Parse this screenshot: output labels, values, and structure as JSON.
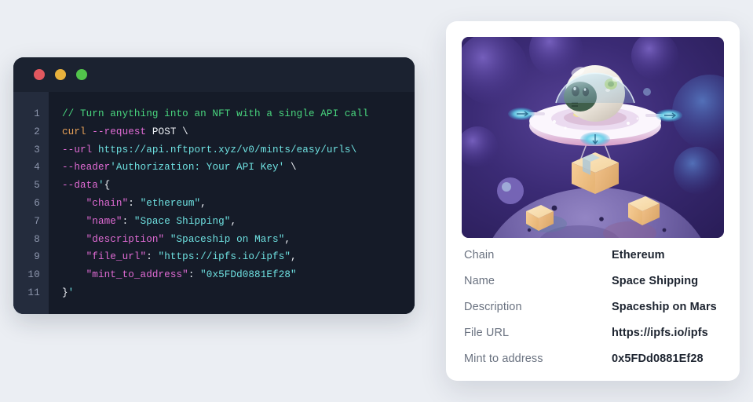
{
  "code_window": {
    "traffic_lights": [
      {
        "name": "close-button",
        "color": "#e2585f"
      },
      {
        "name": "minimize-button",
        "color": "#e8b13c"
      },
      {
        "name": "maximize-button",
        "color": "#52c44b"
      }
    ],
    "line_numbers": [
      "1",
      "2",
      "3",
      "4",
      "5",
      "6",
      "7",
      "8",
      "9",
      "10",
      "11"
    ],
    "lines": [
      {
        "n": "1",
        "tokens": [
          {
            "t": "// Turn anything into an NFT with a single API call",
            "c": "tk-comment"
          }
        ]
      },
      {
        "n": "2",
        "tokens": [
          {
            "t": "curl ",
            "c": "tk-cmd"
          },
          {
            "t": "--request ",
            "c": "tk-flag"
          },
          {
            "t": "POST \\",
            "c": "tk-plain"
          }
        ]
      },
      {
        "n": "3",
        "tokens": [
          {
            "t": "--url ",
            "c": "tk-flag"
          },
          {
            "t": "https://api.nftport.xyz/v0/mints/easy/urls\\",
            "c": "tk-str"
          }
        ]
      },
      {
        "n": "4",
        "tokens": [
          {
            "t": "--header",
            "c": "tk-flag"
          },
          {
            "t": "'Authorization: Your API Key' ",
            "c": "tk-str"
          },
          {
            "t": "\\",
            "c": "tk-plain"
          }
        ]
      },
      {
        "n": "5",
        "tokens": [
          {
            "t": "--data",
            "c": "tk-flag"
          },
          {
            "t": "'",
            "c": "tk-str"
          },
          {
            "t": "{",
            "c": "tk-punct"
          }
        ]
      },
      {
        "n": "6",
        "tokens": [
          {
            "t": "    \"chain\"",
            "c": "tk-key"
          },
          {
            "t": ": ",
            "c": "tk-punct"
          },
          {
            "t": "\"ethereum\"",
            "c": "tk-str"
          },
          {
            "t": ",",
            "c": "tk-punct"
          }
        ]
      },
      {
        "n": "7",
        "tokens": [
          {
            "t": "    \"name\"",
            "c": "tk-key"
          },
          {
            "t": ": ",
            "c": "tk-punct"
          },
          {
            "t": "\"Space Shipping\"",
            "c": "tk-str"
          },
          {
            "t": ",",
            "c": "tk-punct"
          }
        ]
      },
      {
        "n": "8",
        "tokens": [
          {
            "t": "    \"description\"",
            "c": "tk-key"
          },
          {
            "t": " ",
            "c": "tk-punct"
          },
          {
            "t": "\"Spaceship on Mars\"",
            "c": "tk-str"
          },
          {
            "t": ",",
            "c": "tk-punct"
          }
        ]
      },
      {
        "n": "9",
        "tokens": [
          {
            "t": "    \"file_url\"",
            "c": "tk-key"
          },
          {
            "t": ": ",
            "c": "tk-punct"
          },
          {
            "t": "\"https://ipfs.io/ipfs\"",
            "c": "tk-str"
          },
          {
            "t": ",",
            "c": "tk-punct"
          }
        ]
      },
      {
        "n": "10",
        "tokens": [
          {
            "t": "    \"mint_to_address\"",
            "c": "tk-key"
          },
          {
            "t": ": ",
            "c": "tk-punct"
          },
          {
            "t": "\"0x5FDd0881Ef28\"",
            "c": "tk-str"
          }
        ]
      },
      {
        "n": "11",
        "tokens": [
          {
            "t": "}",
            "c": "tk-punct"
          },
          {
            "t": "'",
            "c": "tk-str"
          }
        ]
      }
    ]
  },
  "nft_card": {
    "artwork": {
      "alt": "3D illustration of a cartoon alien in a glass-domed flying saucer drone carrying a cardboard parcel above a purple planet surface",
      "palette": {
        "space_dark": "#2e2160",
        "space_mid": "#4a3a8f",
        "space_light": "#6a57b8",
        "saucer": "#f4eef8",
        "saucer_rim": "#e6b9d8",
        "alien_body": "#f2efe9",
        "alien_face": "#3f5d4a",
        "dome": "#bfe0e8",
        "parcel": "#f7cf9a",
        "parcel_light": "#fae3bd",
        "planet": "#7a6aa8",
        "planet_shadow": "#4c3f7a",
        "thruster": "#5fd0e8"
      }
    },
    "details": [
      {
        "label": "Chain",
        "value": "Ethereum"
      },
      {
        "label": "Name",
        "value": "Space Shipping"
      },
      {
        "label": "Description",
        "value": "Spaceship on Mars"
      },
      {
        "label": "File URL",
        "value": "https://ipfs.io/ipfs"
      },
      {
        "label": "Mint to address",
        "value": "0x5FDd0881Ef28"
      }
    ]
  },
  "page": {
    "background_color": "#ebeef3"
  }
}
